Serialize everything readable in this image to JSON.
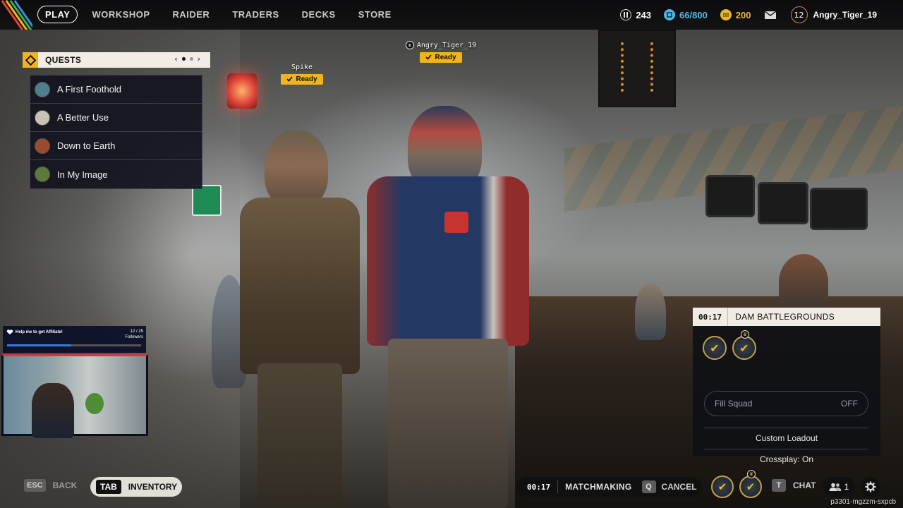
{
  "nav": {
    "items": [
      "PLAY",
      "WORKSHOP",
      "RAIDER",
      "TRADERS",
      "DECKS",
      "STORE"
    ],
    "active": "PLAY"
  },
  "currency": {
    "cred": "243",
    "stash": "66/800",
    "coins": "200"
  },
  "profile": {
    "level": "12",
    "username": "Angry_Tiger_19"
  },
  "quests": {
    "title": "QUESTS",
    "page_prev": "‹",
    "page_next": "›",
    "items": [
      {
        "label": "A First Foothold",
        "portrait_color": "#4f7f8f"
      },
      {
        "label": "A Better Use",
        "portrait_color": "#c8c2b6"
      },
      {
        "label": "Down to Earth",
        "portrait_color": "#9c4a2e"
      },
      {
        "label": "In My Image",
        "portrait_color": "#5c7a3a"
      }
    ]
  },
  "party": {
    "members": [
      {
        "name": "Spike",
        "status": "Ready",
        "leader": false
      },
      {
        "name": "Angry_Tiger_19",
        "status": "Ready",
        "leader": true
      }
    ]
  },
  "stream_overlay": {
    "goal_text": "Help me to get Affiliate!",
    "goal_count": "12 / 25",
    "goal_unit": "Followers",
    "goal_progress": 0.48
  },
  "match": {
    "timer": "00:17",
    "map": "DAM BATTLEGROUNDS",
    "fill_squad_label": "Fill Squad",
    "fill_squad_value": "OFF",
    "custom_loadout": "Custom Loadout",
    "crossplay": "Crossplay: On"
  },
  "bottom": {
    "back_key": "ESC",
    "back_label": "BACK",
    "inventory_key": "TAB",
    "inventory_label": "INVENTORY",
    "mm_timer": "00:17",
    "mm_label": "MATCHMAKING",
    "cancel_key": "Q",
    "cancel_label": "CANCEL",
    "chat_key": "T",
    "chat_label": "CHAT",
    "friends_count": "1",
    "session_id": "p3301-mgzzm-sxpcb"
  },
  "colors": {
    "accent_yellow": "#f2b418",
    "panel_cream": "#f1ece3",
    "panel_dark": "#12141e",
    "stash_blue": "#4fb7e8",
    "coin_gold": "#e8b72a"
  },
  "icons": {
    "cred": "cred-icon",
    "stash": "stash-icon",
    "coins": "coin-icon",
    "mail": "mail-icon",
    "quests": "quest-diamond-icon",
    "ready": "check-icon",
    "leader": "crown-icon",
    "friends": "friends-icon",
    "settings": "gear-icon"
  }
}
